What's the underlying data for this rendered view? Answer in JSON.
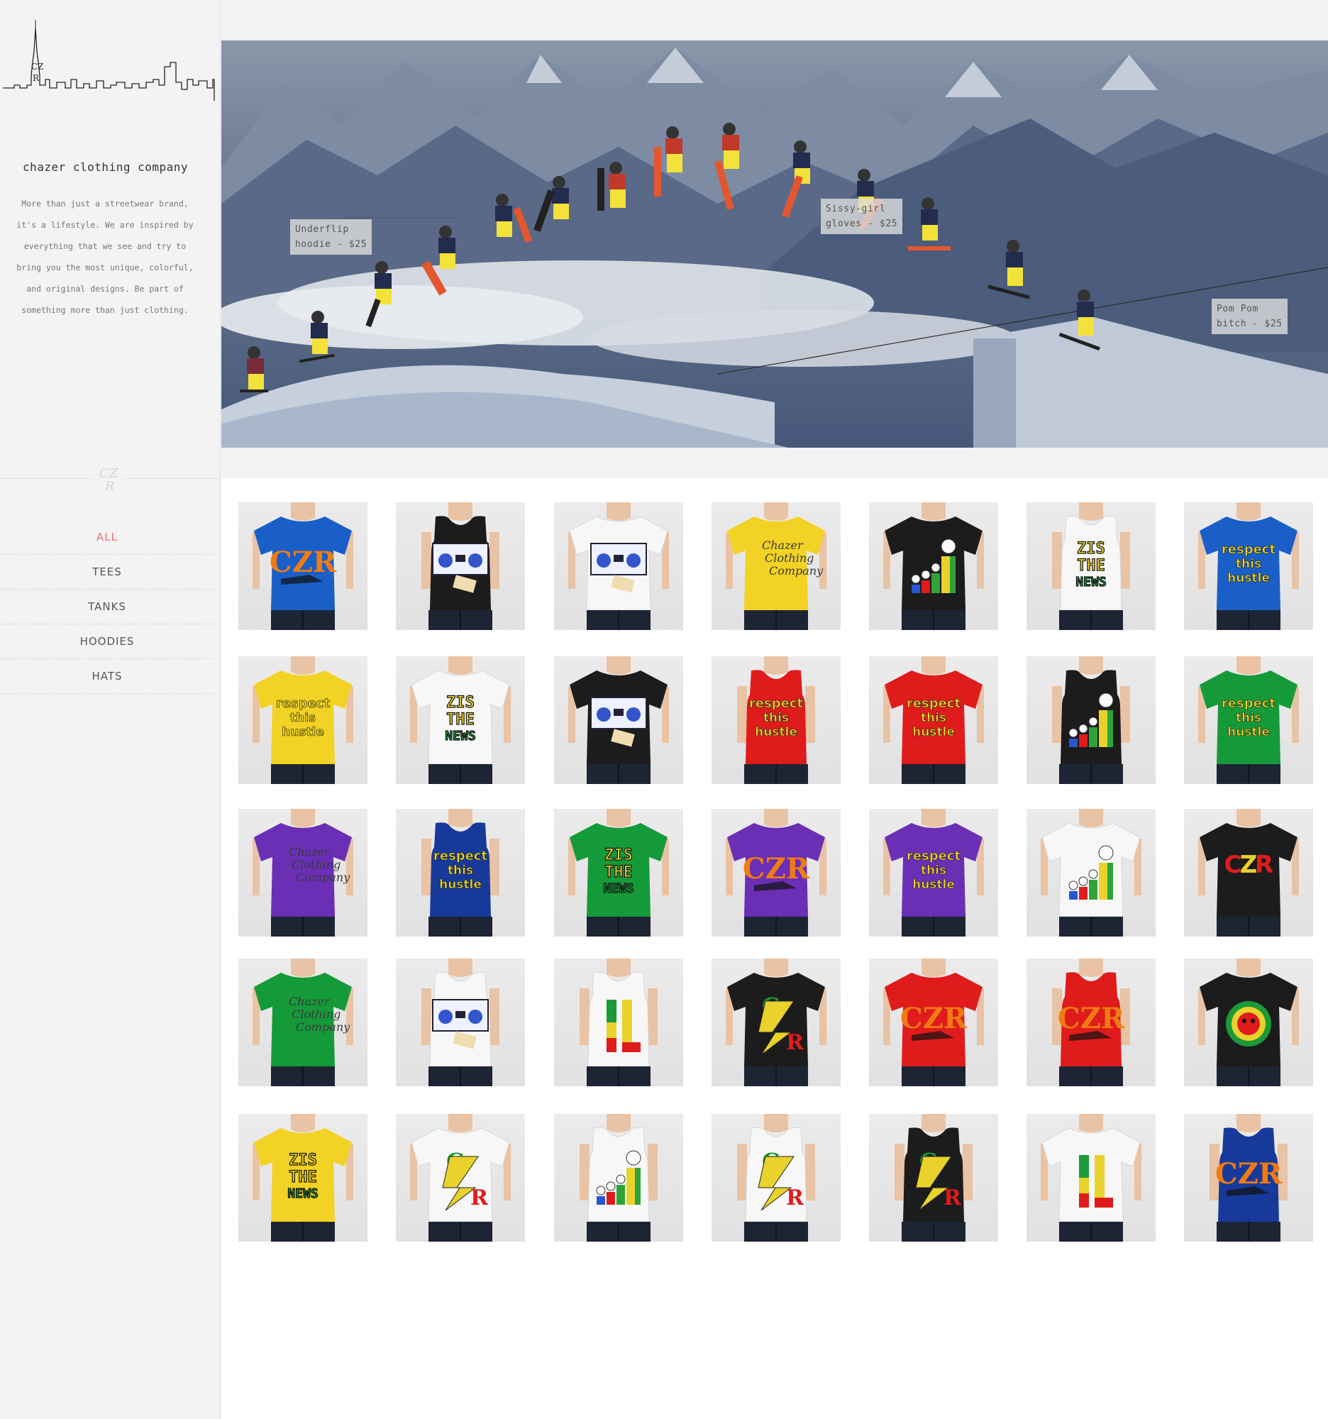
{
  "sidebar": {
    "brand_name": "chazer clothing company",
    "tagline": "More than just a streetwear brand, it's a lifestyle. We are inspired by everything that we see and try to bring you the most unique, colorful, and original designs. Be part of something more than just clothing.",
    "nav": [
      {
        "label": "ALL",
        "active": true
      },
      {
        "label": "TEES",
        "active": false
      },
      {
        "label": "TANKS",
        "active": false
      },
      {
        "label": "HOODIES",
        "active": false
      },
      {
        "label": "HATS",
        "active": false
      }
    ]
  },
  "hero": {
    "hotspots": [
      {
        "line1": "Underflip",
        "line2": "hoodie - $25"
      },
      {
        "line1": "Sissy-girl",
        "line2": "gloves - $25"
      },
      {
        "line1": "Pom Pom",
        "line2": "bitch - $25"
      }
    ]
  },
  "colors": {
    "accent": "#e8756f",
    "shirt_blue": "#1a5fc8",
    "shirt_black": "#1c1c1c",
    "shirt_white": "#f7f7f7",
    "shirt_yellow": "#f2d224",
    "shirt_red": "#e01b1b",
    "shirt_green": "#159a3a",
    "shirt_purple": "#6a2fb5",
    "shirt_navy": "#173a9a"
  },
  "products": [
    {
      "garment": "tee",
      "color": "#1a5fc8",
      "design": "czr-splash"
    },
    {
      "garment": "tank",
      "color": "#1c1c1c",
      "design": "boombox"
    },
    {
      "garment": "tee",
      "color": "#f7f7f7",
      "design": "boombox"
    },
    {
      "garment": "tee",
      "color": "#f2d224",
      "design": "script"
    },
    {
      "garment": "tee",
      "color": "#1c1c1c",
      "design": "skulls"
    },
    {
      "garment": "tank",
      "color": "#f7f7f7",
      "design": "zis-the-news"
    },
    {
      "garment": "tee",
      "color": "#1a5fc8",
      "design": "respect"
    },
    {
      "garment": "tee",
      "color": "#f2d224",
      "design": "respect"
    },
    {
      "garment": "tee",
      "color": "#f7f7f7",
      "design": "zis-the-news"
    },
    {
      "garment": "tee",
      "color": "#1c1c1c",
      "design": "boombox"
    },
    {
      "garment": "tank",
      "color": "#e01b1b",
      "design": "respect"
    },
    {
      "garment": "tee",
      "color": "#e01b1b",
      "design": "respect"
    },
    {
      "garment": "tank",
      "color": "#1c1c1c",
      "design": "skulls"
    },
    {
      "garment": "tee",
      "color": "#159a3a",
      "design": "respect"
    },
    {
      "garment": "tee",
      "color": "#6a2fb5",
      "design": "script"
    },
    {
      "garment": "tank",
      "color": "#173a9a",
      "design": "respect"
    },
    {
      "garment": "tee",
      "color": "#159a3a",
      "design": "zis-the-news"
    },
    {
      "garment": "tee",
      "color": "#6a2fb5",
      "design": "czr-splash"
    },
    {
      "garment": "tee",
      "color": "#6a2fb5",
      "design": "respect"
    },
    {
      "garment": "tee",
      "color": "#f7f7f7",
      "design": "skulls"
    },
    {
      "garment": "tee",
      "color": "#1c1c1c",
      "design": "czr-rasta"
    },
    {
      "garment": "tee",
      "color": "#159a3a",
      "design": "script"
    },
    {
      "garment": "tank",
      "color": "#f7f7f7",
      "design": "boombox"
    },
    {
      "garment": "tank",
      "color": "#f7f7f7",
      "design": "one-love"
    },
    {
      "garment": "tee",
      "color": "#1c1c1c",
      "design": "cz-bolt"
    },
    {
      "garment": "tee",
      "color": "#e01b1b",
      "design": "czr-splash"
    },
    {
      "garment": "tank",
      "color": "#e01b1b",
      "design": "czr-splash"
    },
    {
      "garment": "tee",
      "color": "#1c1c1c",
      "design": "lion"
    },
    {
      "garment": "tee",
      "color": "#f2d224",
      "design": "zis-the-news"
    },
    {
      "garment": "tee",
      "color": "#f7f7f7",
      "design": "cz-bolt"
    },
    {
      "garment": "tank",
      "color": "#f7f7f7",
      "design": "skulls"
    },
    {
      "garment": "tank",
      "color": "#f7f7f7",
      "design": "cz-bolt"
    },
    {
      "garment": "tank",
      "color": "#1c1c1c",
      "design": "cz-bolt"
    },
    {
      "garment": "tee",
      "color": "#f7f7f7",
      "design": "one-love"
    },
    {
      "garment": "tank",
      "color": "#173a9a",
      "design": "czr-splash"
    }
  ]
}
